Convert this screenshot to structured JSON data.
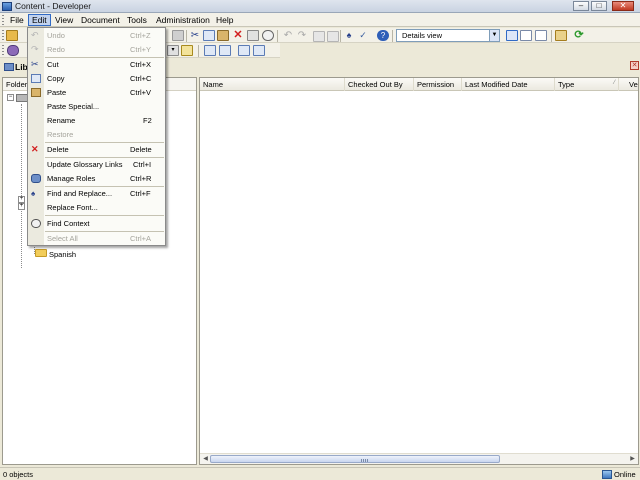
{
  "window": {
    "title": "Content - Developer"
  },
  "menubar": {
    "items": [
      "File",
      "Edit",
      "View",
      "Document",
      "Tools",
      "Administration",
      "Help"
    ],
    "active": "Edit"
  },
  "toolbar": {
    "view_mode": "Details view"
  },
  "library": {
    "tab_label": "Lib"
  },
  "folders": {
    "header": "Folders",
    "visible_item": "Spanish"
  },
  "content_list": {
    "columns": [
      "Name",
      "Checked Out By",
      "Permission",
      "Last Modified Date",
      "Type",
      "Ve"
    ],
    "rows": []
  },
  "statusbar": {
    "objects": "0 objects",
    "connection": "Online"
  },
  "edit_menu": {
    "items": [
      {
        "label": "Undo",
        "shortcut": "Ctrl+Z",
        "enabled": false,
        "icon": "undo-icon"
      },
      {
        "label": "Redo",
        "shortcut": "Ctrl+Y",
        "enabled": false,
        "icon": "redo-icon"
      },
      {
        "label": "Cut",
        "shortcut": "Ctrl+X",
        "enabled": true,
        "icon": "scissors-icon"
      },
      {
        "label": "Copy",
        "shortcut": "Ctrl+C",
        "enabled": true,
        "icon": "copy-icon"
      },
      {
        "label": "Paste",
        "shortcut": "Ctrl+V",
        "enabled": true,
        "icon": "paste-icon"
      },
      {
        "label": "Paste Special...",
        "shortcut": "",
        "enabled": true,
        "icon": ""
      },
      {
        "label": "Rename",
        "shortcut": "F2",
        "enabled": true,
        "icon": ""
      },
      {
        "label": "Restore",
        "shortcut": "",
        "enabled": false,
        "icon": ""
      },
      {
        "label": "Delete",
        "shortcut": "Delete",
        "enabled": true,
        "icon": "delete-x-icon"
      },
      {
        "label": "Update Glossary Links",
        "shortcut": "Ctrl+I",
        "enabled": true,
        "icon": ""
      },
      {
        "label": "Manage Roles",
        "shortcut": "Ctrl+R",
        "enabled": true,
        "icon": "manage-roles-icon"
      },
      {
        "label": "Find and Replace...",
        "shortcut": "Ctrl+F",
        "enabled": true,
        "icon": "binoculars-icon"
      },
      {
        "label": "Replace Font...",
        "shortcut": "",
        "enabled": true,
        "icon": ""
      },
      {
        "label": "Find Context",
        "shortcut": "",
        "enabled": true,
        "icon": "find-context-icon"
      },
      {
        "label": "Select All",
        "shortcut": "Ctrl+A",
        "enabled": false,
        "icon": ""
      }
    ]
  },
  "colors": {
    "menu_highlight": "#c1d2ee",
    "menu_highlight_border": "#316ac5",
    "chrome": "#ece9d8",
    "delete_red": "#d21e1e"
  }
}
